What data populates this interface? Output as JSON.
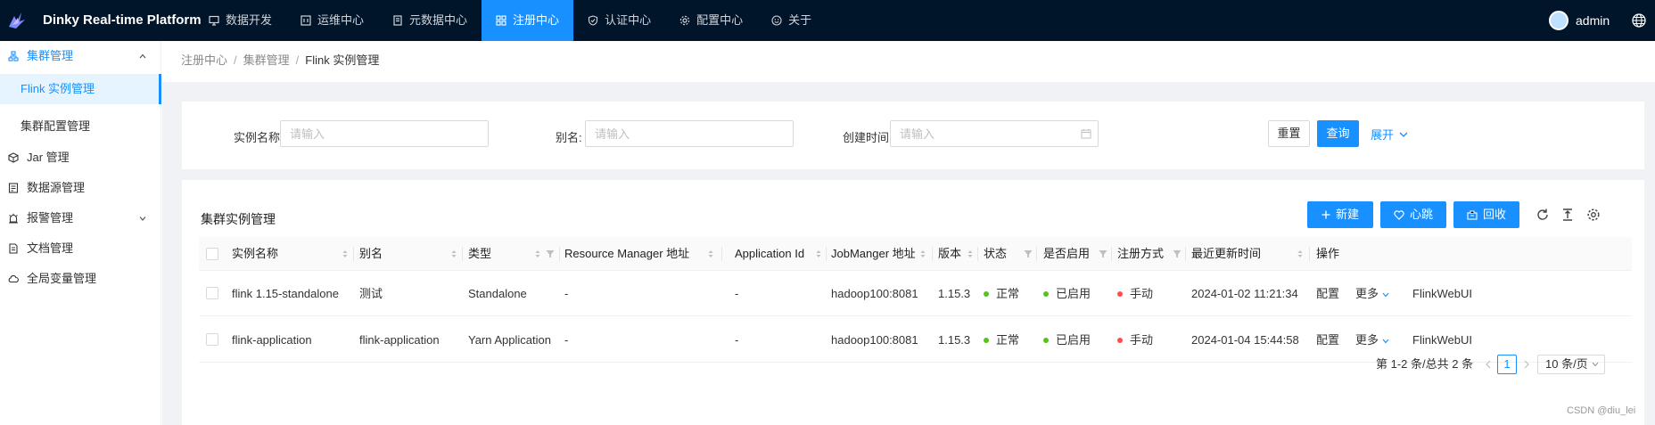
{
  "header": {
    "app_title": "Dinky Real-time Platform",
    "nav": [
      {
        "label": "数据开发",
        "icon": "desktop-icon"
      },
      {
        "label": "运维中心",
        "icon": "monitor-icon"
      },
      {
        "label": "元数据中心",
        "icon": "database-icon"
      },
      {
        "label": "注册中心",
        "icon": "grid-icon",
        "active": true
      },
      {
        "label": "认证中心",
        "icon": "shield-check-icon"
      },
      {
        "label": "配置中心",
        "icon": "gear-icon"
      },
      {
        "label": "关于",
        "icon": "smile-icon"
      }
    ],
    "user": "admin",
    "accent": "#1890ff",
    "bg": "#001529"
  },
  "sidebar": {
    "items": [
      {
        "label": "集群管理",
        "icon": "cluster-icon",
        "expanded": true
      },
      {
        "label": "Flink 实例管理",
        "selected": true
      },
      {
        "label": "集群配置管理"
      },
      {
        "label": "Jar 管理",
        "icon": "jar-icon"
      },
      {
        "label": "数据源管理",
        "icon": "datasource-icon"
      },
      {
        "label": "报警管理",
        "icon": "alarm-icon",
        "expanded": false
      },
      {
        "label": "文档管理",
        "icon": "document-icon"
      },
      {
        "label": "全局变量管理",
        "icon": "cloud-icon"
      }
    ]
  },
  "breadcrumb": [
    "注册中心",
    "集群管理",
    "Flink 实例管理"
  ],
  "search": {
    "name_label": "实例名称:",
    "name_placeholder": "请输入",
    "alias_label": "别名:",
    "alias_placeholder": "请输入",
    "created_label": "创建时间:",
    "created_placeholder": "请输入",
    "reset": "重置",
    "query": "查询",
    "expand": "展开"
  },
  "table_card": {
    "title": "集群实例管理",
    "new": "新建",
    "heartbeat": "心跳",
    "recycle": "回收"
  },
  "columns": [
    "实例名称",
    "别名",
    "类型",
    "Resource Manager 地址",
    "Application Id",
    "JobManger 地址",
    "版本",
    "状态",
    "是否启用",
    "注册方式",
    "最近更新时间",
    "操作"
  ],
  "rows": [
    {
      "name": "flink 1.15-standalone",
      "alias": "测试",
      "type": "Standalone",
      "rm_addr": "-",
      "app_id": "-",
      "jm_addr": "hadoop100:8081",
      "version": "1.15.3",
      "status": "正常",
      "enabled": "已启用",
      "register": "手动",
      "updated": "2024-01-02 11:21:34",
      "op_config": "配置",
      "op_more": "更多",
      "op_webui": "FlinkWebUI"
    },
    {
      "name": "flink-application",
      "alias": "flink-application",
      "type": "Yarn Application",
      "rm_addr": "-",
      "app_id": "-",
      "jm_addr": "hadoop100:8081",
      "version": "1.15.3",
      "status": "正常",
      "enabled": "已启用",
      "register": "手动",
      "updated": "2024-01-04 15:44:58",
      "op_config": "配置",
      "op_more": "更多",
      "op_webui": "FlinkWebUI"
    }
  ],
  "status_colors": {
    "ok": "#52c41a",
    "manual": "#ff4d4f"
  },
  "pagination": {
    "summary": "第 1-2 条/总共 2 条",
    "current": "1",
    "page_size": "10 条/页"
  },
  "credit": "CSDN @diu_lei"
}
